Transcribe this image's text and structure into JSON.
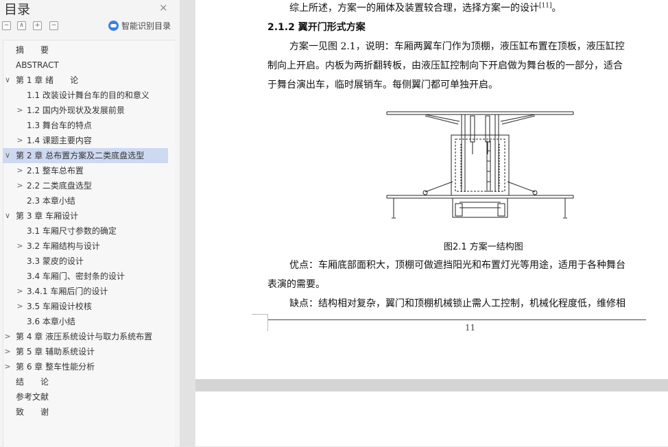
{
  "sidebar": {
    "title": "目录",
    "close_symbol": "×",
    "toolbar": {
      "collapse": "−",
      "expand_up": "∧",
      "add": "+",
      "remove": "−"
    },
    "smart_label": "智能识别目录",
    "items": [
      {
        "label": "摘　　要",
        "chevron": "",
        "level": 0
      },
      {
        "label": "ABSTRACT",
        "chevron": "",
        "level": 0
      },
      {
        "label": "第 1 章  绪　　论",
        "chevron": "∨",
        "level": 0
      },
      {
        "label": "1.1  改装设计舞台车的目的和意义",
        "chevron": "",
        "level": 1
      },
      {
        "label": "1.2  国内外现状及发展前景",
        "chevron": ">",
        "level": 1
      },
      {
        "label": "1.3  舞台车的特点",
        "chevron": "",
        "level": 1
      },
      {
        "label": "1.4 课题主要内容",
        "chevron": ">",
        "level": 1
      },
      {
        "label": "第 2 章  总布置方案及二类底盘选型",
        "chevron": "∨",
        "level": 0,
        "selected": true
      },
      {
        "label": "2.1  整车总布置",
        "chevron": ">",
        "level": 1
      },
      {
        "label": "2.2  二类底盘选型",
        "chevron": ">",
        "level": 1
      },
      {
        "label": "2.3  本章小结",
        "chevron": "",
        "level": 1
      },
      {
        "label": "第 3 章  车厢设计",
        "chevron": "∨",
        "level": 0
      },
      {
        "label": "3.1  车厢尺寸参数的确定",
        "chevron": "",
        "level": 1
      },
      {
        "label": "3.2  车厢结构与设计",
        "chevron": ">",
        "level": 1
      },
      {
        "label": "3.3  蒙皮的设计",
        "chevron": "",
        "level": 1
      },
      {
        "label": "3.4  车厢门、密封条的设计",
        "chevron": "",
        "level": 1
      },
      {
        "label": "3.4.1  车厢后门的设计",
        "chevron": ">",
        "level": 1
      },
      {
        "label": "3.5  车厢设计校核",
        "chevron": ">",
        "level": 1
      },
      {
        "label": "3.6  本章小结",
        "chevron": "",
        "level": 1
      },
      {
        "label": "第 4 章  液压系统设计与取力系统布置",
        "chevron": ">",
        "level": 0
      },
      {
        "label": "第 5 章  辅助系统设计",
        "chevron": ">",
        "level": 0
      },
      {
        "label": "第  6  章  整车性能分析",
        "chevron": ">",
        "level": 0
      },
      {
        "label": "结　　论",
        "chevron": "",
        "level": 0
      },
      {
        "label": "参考文献",
        "chevron": "",
        "level": 0
      },
      {
        "label": "致　　谢",
        "chevron": "",
        "level": 0
      }
    ]
  },
  "document": {
    "line_conclusion": "综上所述，方案一的厢体及装置较合理，选择方案一的设计",
    "citation": "[11]",
    "line_conclusion_end": "。",
    "heading": "2.1.2  翼开门形式方案",
    "para1_l1": "方案一见图 2.1，说明：车厢两翼车门作为顶棚，液压缸布置在顶板，液压缸控",
    "para1_l2": "制向上开启。内板为两折翻转板，由液压缸控制向下开启做为舞台板的一部分，适合",
    "para1_l3": "于舞台演出车，临时展销车。每侧翼门都可单独开启。",
    "figure_caption": "图2.1  方案一结构图",
    "para2_l1": "优点：车厢底部面积大，顶棚可做遮挡阳光和布置灯光等用途，适用于各种舞台",
    "para2_l2": "表演的需要。",
    "para3_l1": "缺点：结构相对复杂，翼门和顶棚机械锁止需人工控制，机械化程度低，维修相",
    "page_number": "11"
  },
  "colors": {
    "accent": "#3b7fe8",
    "selected_bg": "#cdd9f1"
  },
  "icons": [
    "close-icon",
    "collapse-all-icon",
    "expand-up-icon",
    "add-icon",
    "remove-icon",
    "smart-recognition-icon",
    "chevron-right-icon",
    "chevron-down-icon"
  ]
}
